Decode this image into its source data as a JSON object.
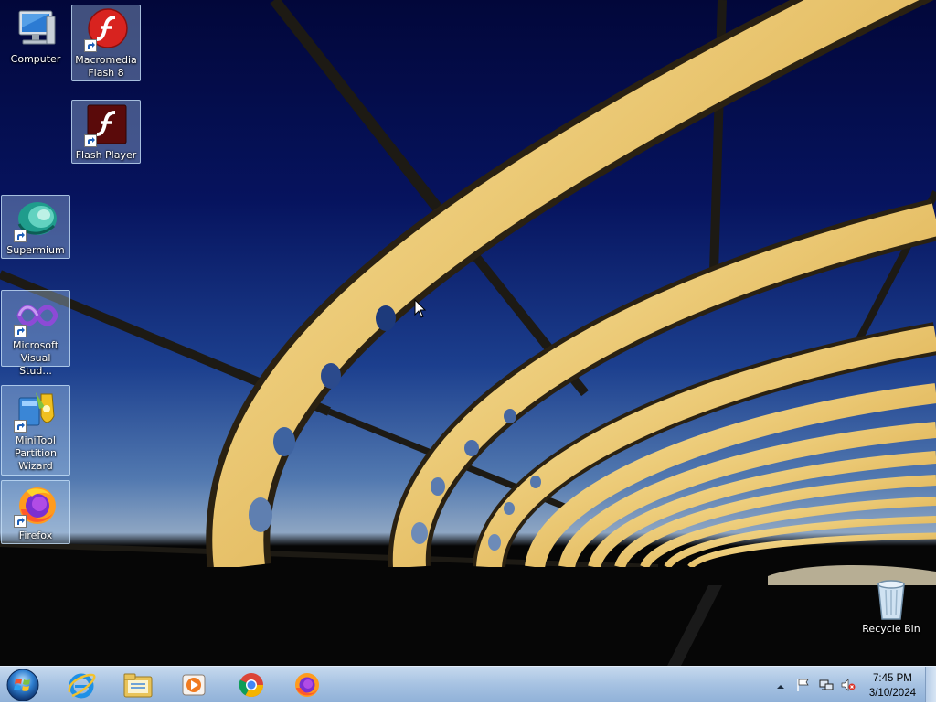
{
  "desktop": {
    "icons": [
      {
        "id": "computer",
        "label": "Computer",
        "icon": "computer-icon",
        "shortcut": false
      },
      {
        "id": "macromedia-flash",
        "label": "Macromedia Flash 8",
        "icon": "macromedia-flash-icon",
        "shortcut": true
      },
      {
        "id": "flash-player",
        "label": "Flash Player",
        "icon": "flash-player-icon",
        "shortcut": true
      },
      {
        "id": "supermium",
        "label": "Supermium",
        "icon": "supermium-icon",
        "shortcut": true
      },
      {
        "id": "visual-studio",
        "label": "Microsoft Visual Stud...",
        "icon": "visual-studio-icon",
        "shortcut": true
      },
      {
        "id": "minitool",
        "label": "MiniTool Partition Wizard",
        "icon": "minitool-partition-wizard-icon",
        "shortcut": true
      },
      {
        "id": "firefox",
        "label": "Firefox",
        "icon": "firefox-icon",
        "shortcut": true
      },
      {
        "id": "recycle-bin",
        "label": "Recycle Bin",
        "icon": "recycle-bin-icon",
        "shortcut": false
      }
    ]
  },
  "taskbar": {
    "start": {
      "icon": "windows-start-orb-icon"
    },
    "pinned": [
      {
        "name": "Internet Explorer",
        "icon": "internet-explorer-icon"
      },
      {
        "name": "Windows Explorer",
        "icon": "file-explorer-icon"
      },
      {
        "name": "Windows Media Player",
        "icon": "media-player-icon"
      },
      {
        "name": "Google Chrome",
        "icon": "chrome-icon"
      },
      {
        "name": "Firefox",
        "icon": "firefox-icon"
      }
    ],
    "tray": {
      "icons": [
        "show-hidden-icons-arrow-icon",
        "action-center-flag-icon",
        "network-icon",
        "volume-muted-icon"
      ],
      "time": "7:45 PM",
      "date": "3/10/2024"
    }
  },
  "colors": {
    "sky_top": "#02073a",
    "sky_horizon": "#8ea6c3",
    "bridge_gold": "#e8c56a",
    "taskbar": "#a6c2e2"
  }
}
